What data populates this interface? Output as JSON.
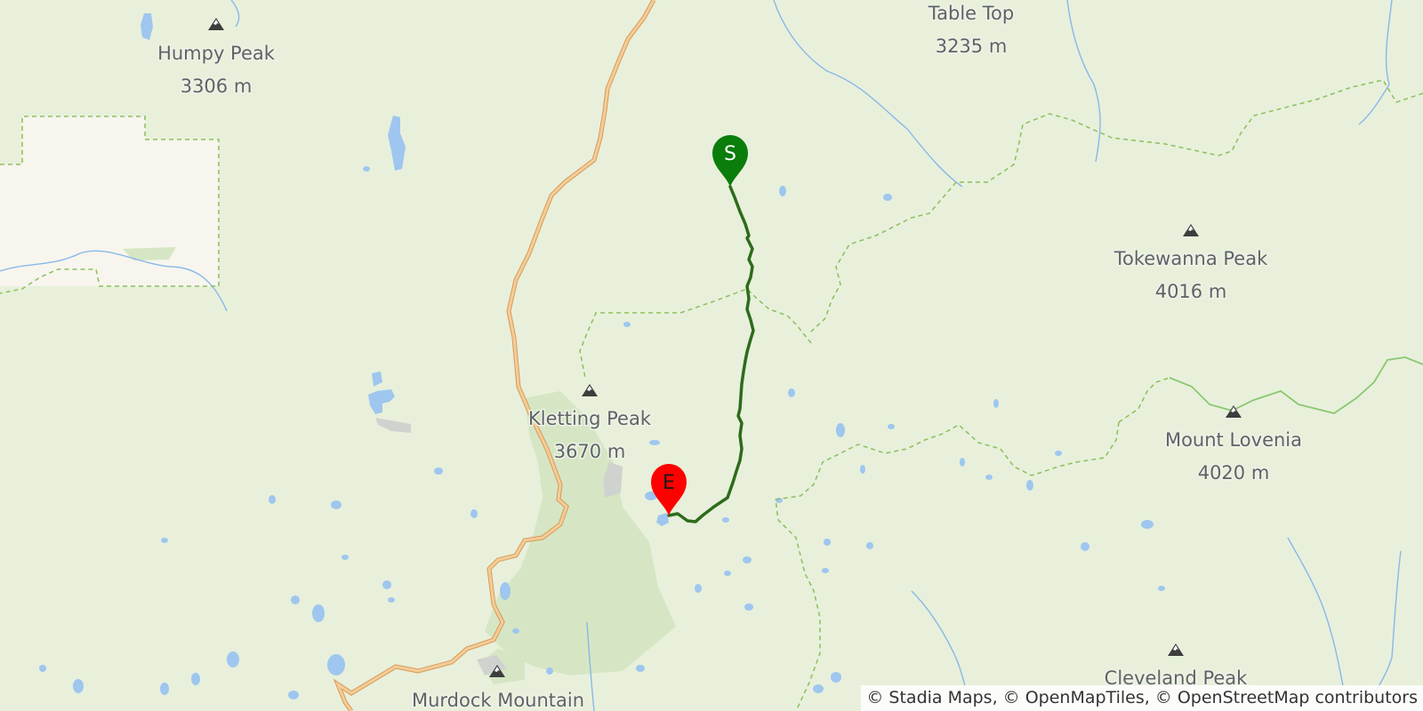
{
  "map": {
    "colors": {
      "land": "#e8f0db",
      "forest": "#d6e6c4",
      "private_land": "#f7f5ee",
      "water": "#9ec6ef",
      "stream": "#88b8e8",
      "road": "#efb87a",
      "road_casing": "#d99a55",
      "boundary": "#8cbf5c",
      "boundary_solid": "#8cc772",
      "route": "#2e6b1c",
      "start_marker": "#0a7d0a",
      "end_marker": "#ff0000"
    },
    "peaks": [
      {
        "name": "Humpy Peak",
        "elevation": "3306 m"
      },
      {
        "name": "Table Top",
        "elevation": "3235 m"
      },
      {
        "name": "Tokewanna Peak",
        "elevation": "4016 m"
      },
      {
        "name": "Kletting Peak",
        "elevation": "3670 m"
      },
      {
        "name": "Mount Lovenia",
        "elevation": "4020 m"
      },
      {
        "name": "Cleveland Peak",
        "elevation": ""
      },
      {
        "name": "Murdock Mountain",
        "elevation": ""
      }
    ],
    "markers": {
      "start": {
        "label": "S"
      },
      "end": {
        "label": "E"
      }
    },
    "attribution": "© Stadia Maps, © OpenMapTiles, © OpenStreetMap contributors"
  }
}
